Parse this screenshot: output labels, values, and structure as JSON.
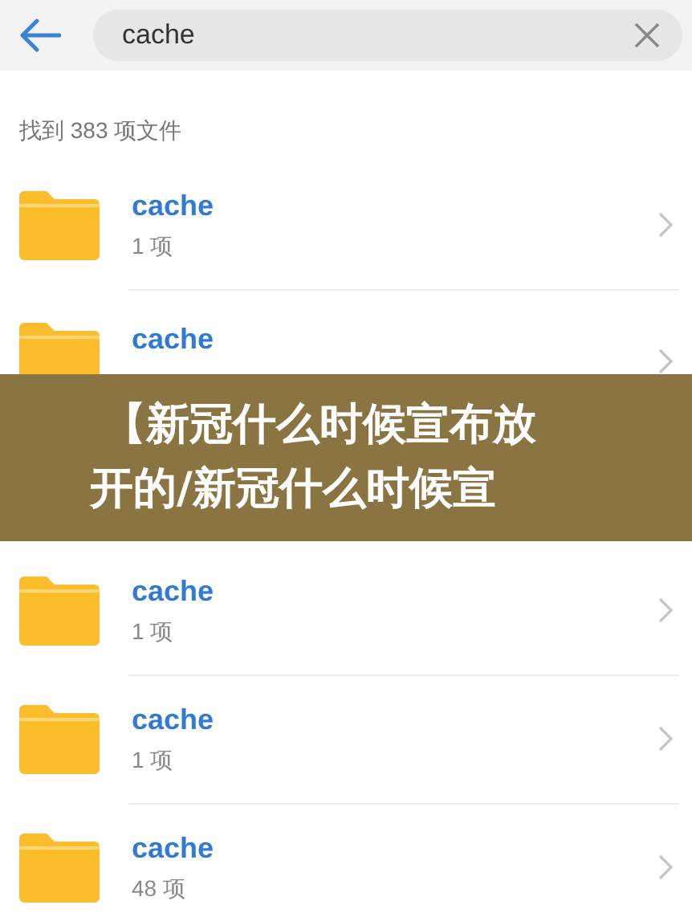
{
  "search": {
    "value": "cache"
  },
  "result_count": "找到 383 项文件",
  "folders_above": [
    {
      "name": "cache",
      "count": "1 项"
    },
    {
      "name": "cache"
    }
  ],
  "banner": {
    "line_1": "【新冠什么时候宣布放",
    "line_2": "开的/新冠什么时候宣"
  },
  "folders_below": [
    {
      "name": "cache",
      "count": "1 项"
    },
    {
      "name": "cache",
      "count": "1 项"
    },
    {
      "name": "cache",
      "count": "48 项"
    }
  ]
}
